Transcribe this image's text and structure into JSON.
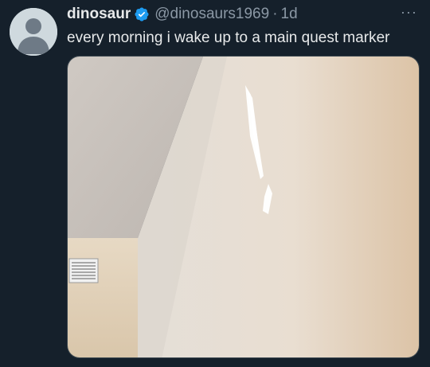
{
  "tweet": {
    "avatar_icon": "default-profile-icon",
    "display_name": "dinosaur",
    "verified_icon": "verified-badge-icon",
    "handle": "@dinosaurs1969",
    "separator": "·",
    "timestamp": "1d",
    "more_icon": "more-options-icon",
    "more_label": "···",
    "text": "every morning i wake up to a main quest marker",
    "media_icon": "photo-wall-light-exclamation"
  },
  "colors": {
    "background": "#15202b",
    "primary_text": "#e7e9ea",
    "secondary_text": "#8b98a5",
    "verified_blue": "#1d9bf0"
  }
}
